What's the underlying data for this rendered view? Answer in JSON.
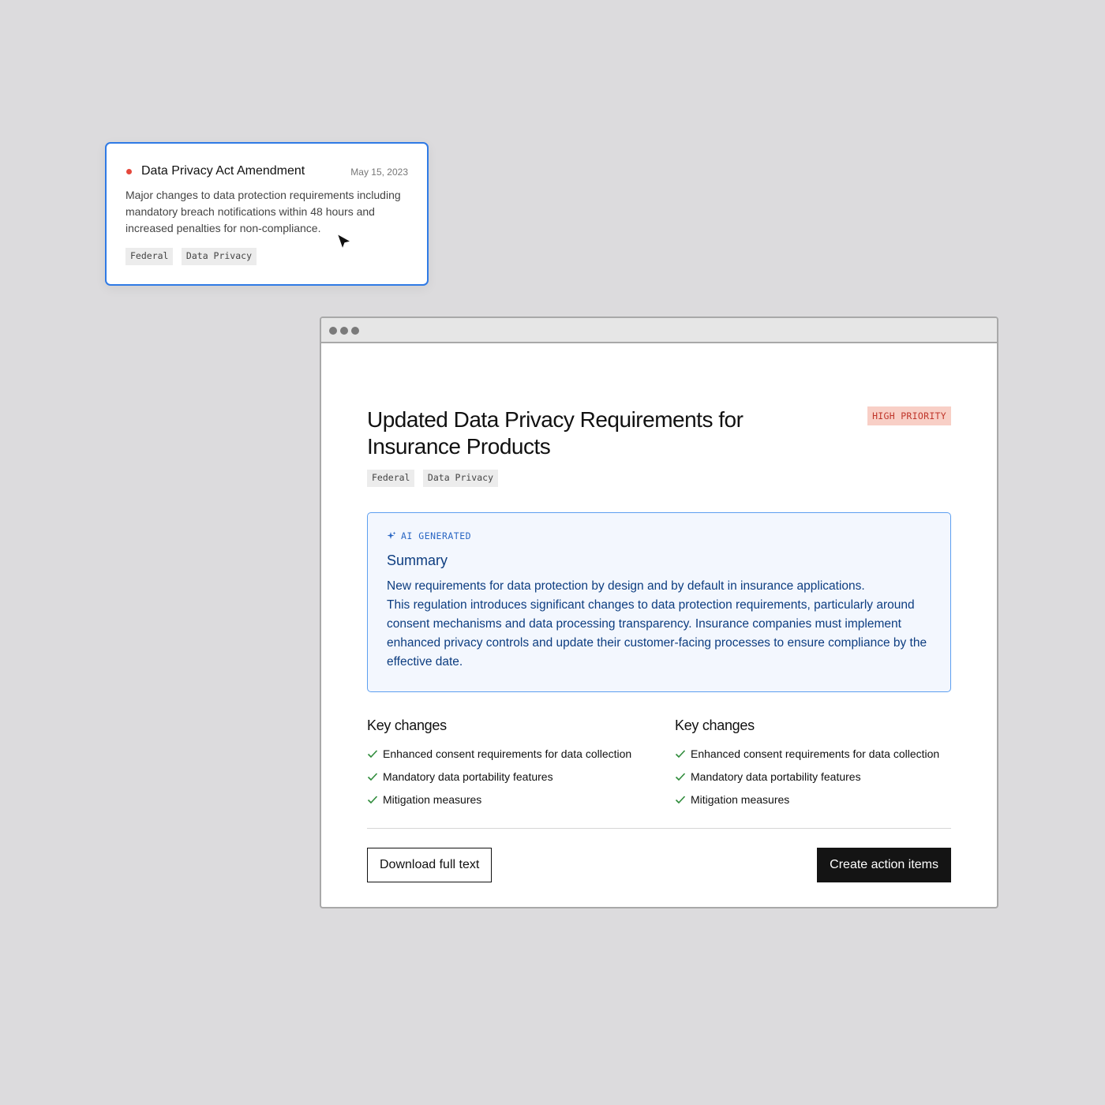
{
  "notification_card": {
    "title": "Data Privacy Act Amendment",
    "date": "May 15, 2023",
    "description": "Major changes to data protection requirements including mandatory breach notifications within 48 hours and increased penalties for non-compliance.",
    "tags": [
      "Federal",
      "Data Privacy"
    ],
    "status_color": "#e5483c"
  },
  "document": {
    "title": "Updated Data Privacy Requirements for Insurance Products",
    "priority_badge": "HIGH PRIORITY",
    "tags": [
      "Federal",
      "Data Privacy"
    ],
    "ai_summary": {
      "label": "AI GENERATED",
      "heading": "Summary",
      "lead": "New requirements for data protection by design and by default in insurance applications.",
      "body": "This regulation introduces significant changes to data protection requirements, particularly around consent mechanisms and data processing transparency. Insurance companies must implement enhanced privacy controls and update their customer-facing processes to ensure compliance by the effective date."
    },
    "key_changes_columns": [
      {
        "heading": "Key changes",
        "items": [
          "Enhanced consent requirements for data collection",
          "Mandatory data portability features",
          "Mitigation measures"
        ]
      },
      {
        "heading": "Key changes",
        "items": [
          "Enhanced consent requirements for data collection",
          "Mandatory data portability features",
          "Mitigation measures"
        ]
      }
    ],
    "actions": {
      "download_label": "Download full text",
      "create_label": "Create action items"
    }
  },
  "colors": {
    "accent_blue": "#2f7ae5",
    "priority_bg": "#f8cfc6",
    "priority_text": "#c0362b",
    "summary_text": "#0d3d80",
    "check_green": "#2e8b3a"
  },
  "icons": {
    "window_controls": "window-dots-icon",
    "ai": "sparkle-icon",
    "check": "check-icon",
    "cursor": "mouse-cursor-icon"
  }
}
